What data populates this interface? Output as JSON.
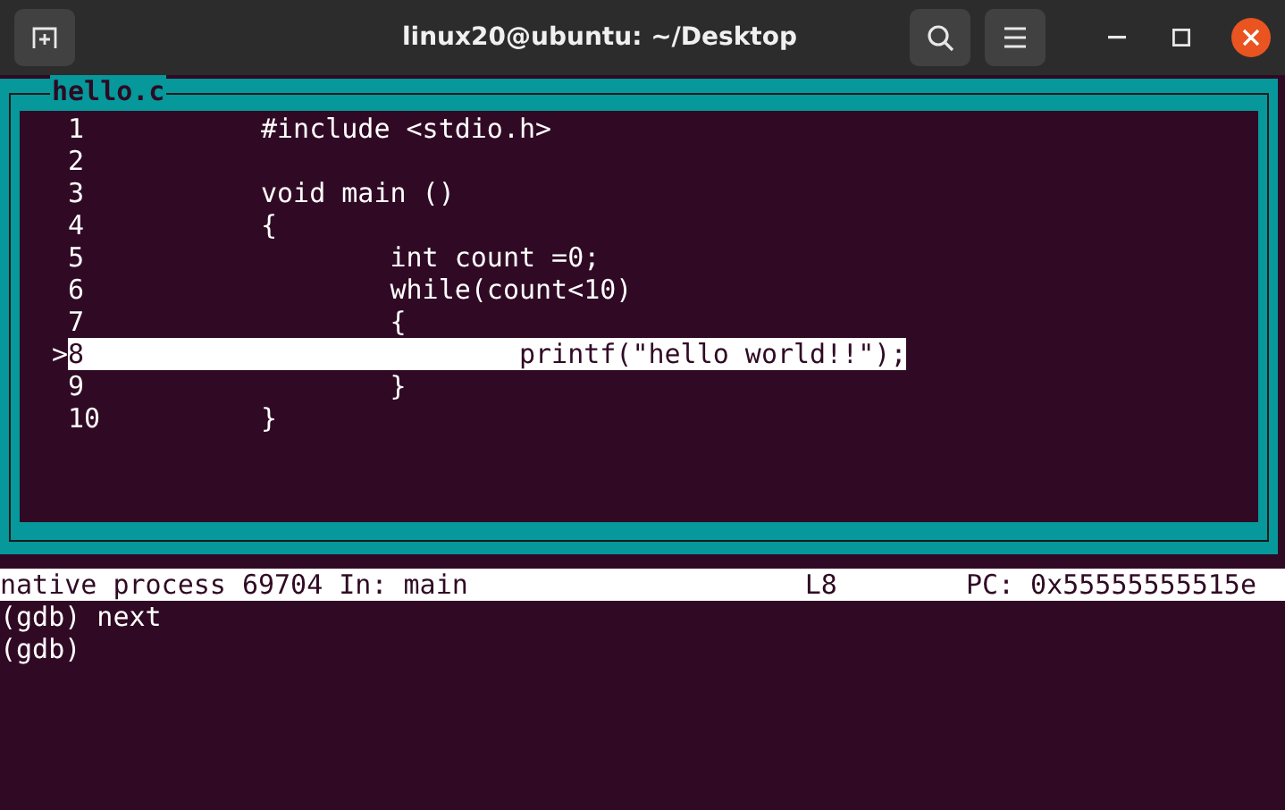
{
  "window": {
    "title": "linux20@ubuntu: ~/Desktop"
  },
  "source": {
    "title": "hello.c",
    "lines": [
      {
        "number": "1",
        "code": "#include <stdio.h>",
        "selected": false
      },
      {
        "number": "2",
        "selected": false
      },
      {
        "number": "3",
        "code": "void main ()",
        "selected": false
      },
      {
        "number": "4",
        "code": "{",
        "selected": false
      },
      {
        "number": "5",
        "code": "\tint count =0;",
        "selected": false
      },
      {
        "number": "6",
        "code": "\twhile(count<10)",
        "selected": false
      },
      {
        "number": "7",
        "code": "\t{",
        "selected": false
      },
      {
        "number": "8",
        "code": "\t\tprintf(\"hello world!!\");",
        "selected": true,
        "marker": ">"
      },
      {
        "number": "9",
        "code": "\t}",
        "selected": false
      },
      {
        "number": "10",
        "code": "}",
        "selected": false
      }
    ]
  },
  "status_bar": {
    "process": "native process 69704 In: main",
    "line": "L8",
    "pc": "PC: 0x55555555515e"
  },
  "console": [
    "(gdb) next",
    "(gdb)"
  ]
}
